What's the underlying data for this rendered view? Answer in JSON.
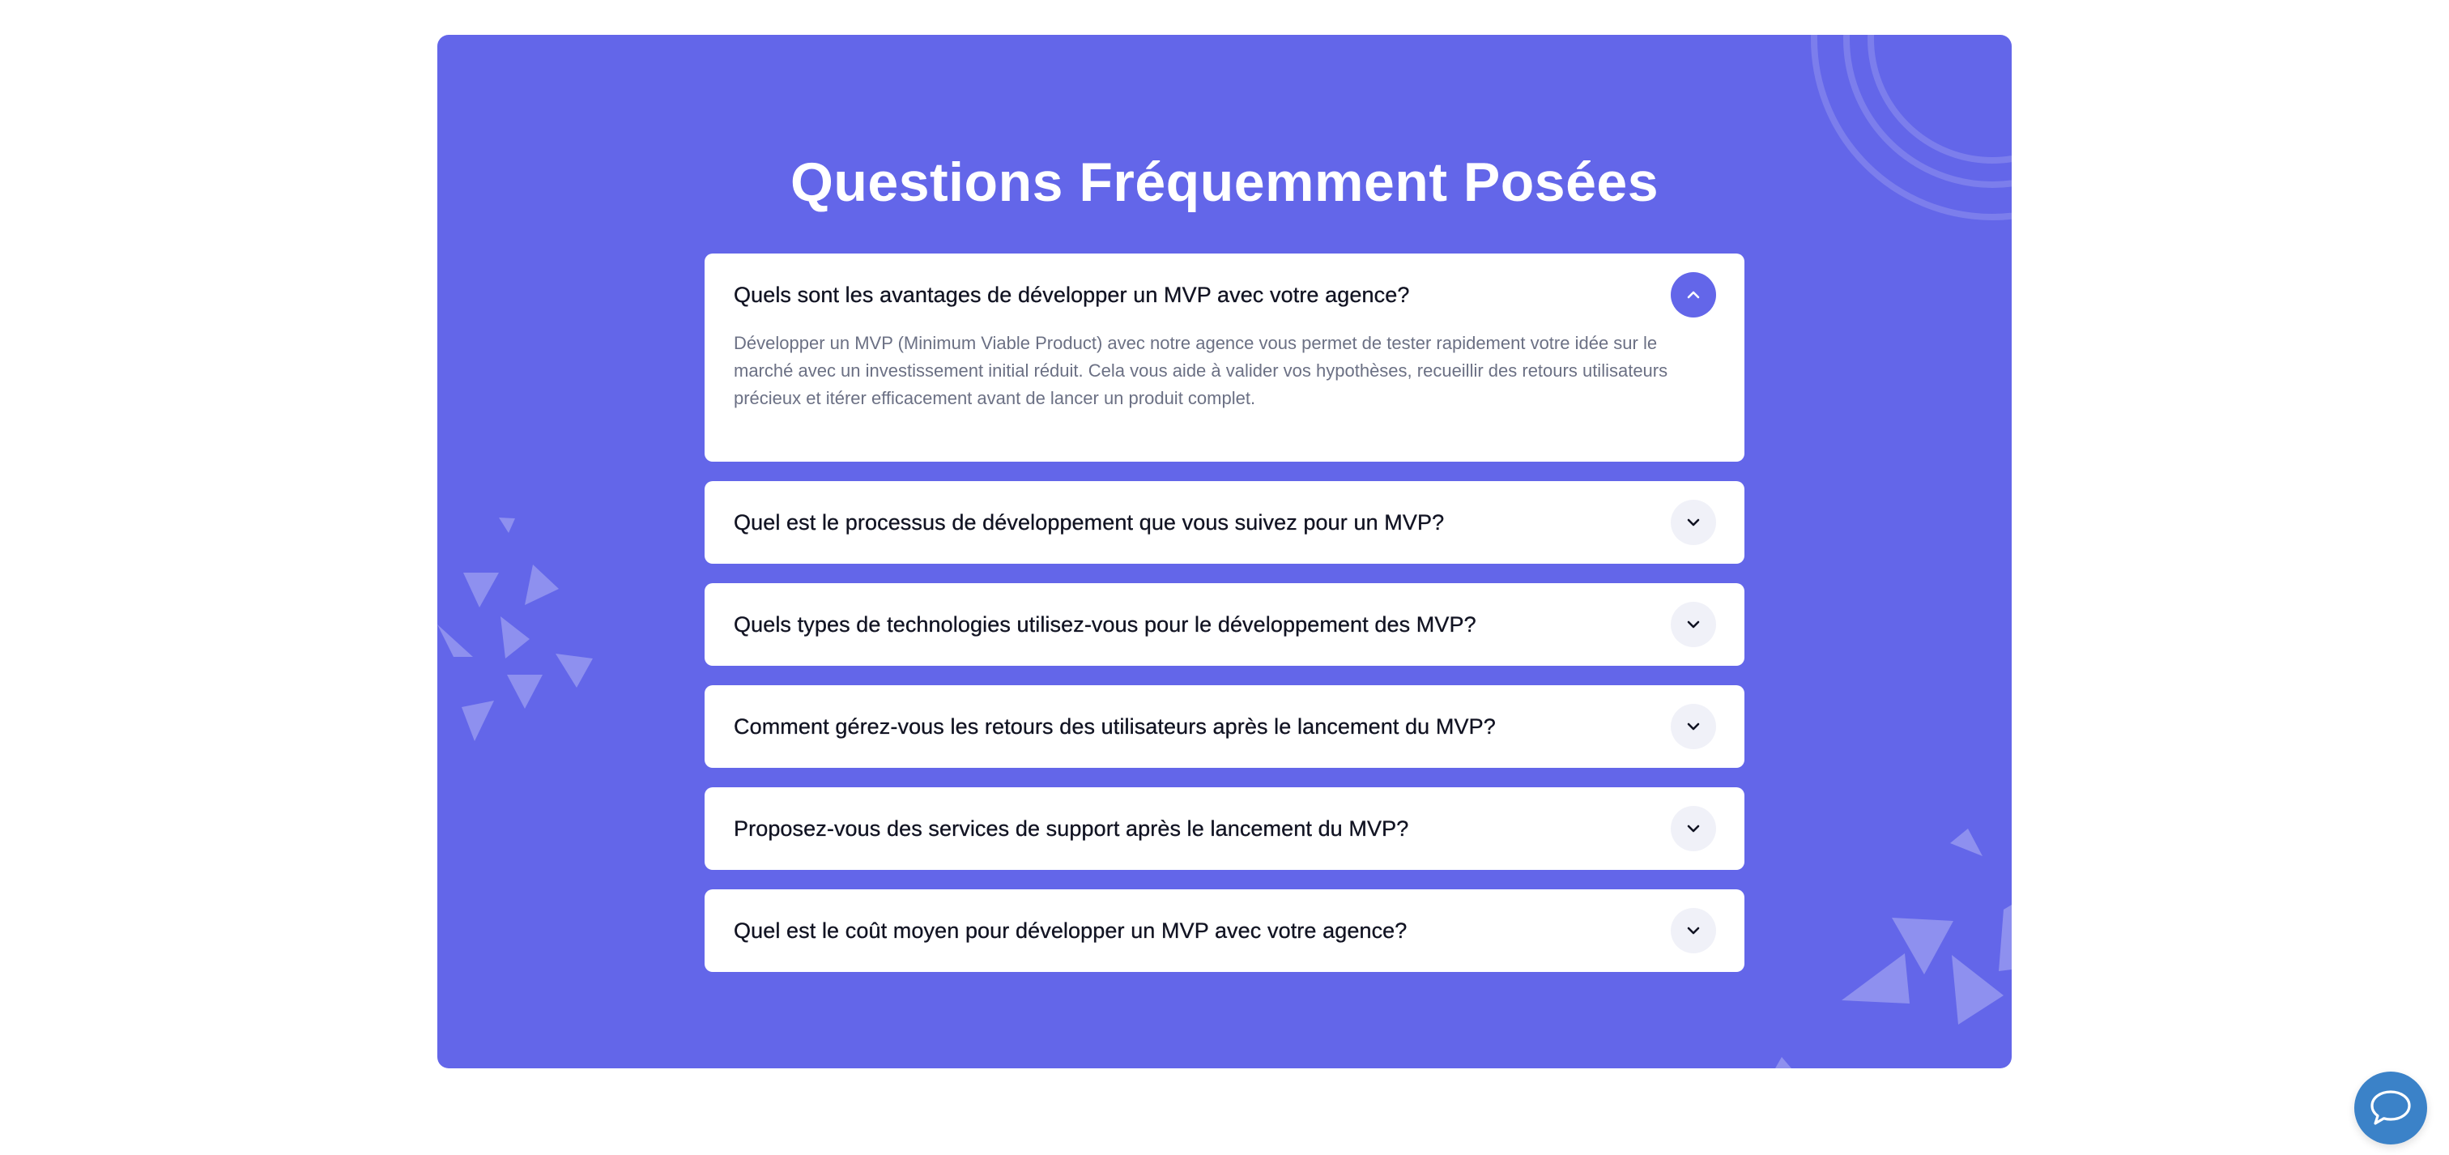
{
  "faq": {
    "title": "Questions Fréquemment Posées",
    "items": [
      {
        "question": "Quels sont les avantages de développer un MVP avec votre agence?",
        "answer": "Développer un MVP (Minimum Viable Product) avec notre agence vous permet de tester rapidement votre idée sur le marché avec un investissement initial réduit. Cela vous aide à valider vos hypothèses, recueillir des retours utilisateurs précieux et itérer efficacement avant de lancer un produit complet.",
        "expanded": true
      },
      {
        "question": "Quel est le processus de développement que vous suivez pour un MVP?",
        "expanded": false
      },
      {
        "question": "Quels types de technologies utilisez-vous pour le développement des MVP?",
        "expanded": false
      },
      {
        "question": "Comment gérez-vous les retours des utilisateurs après le lancement du MVP?",
        "expanded": false
      },
      {
        "question": "Proposez-vous des services de support après le lancement du MVP?",
        "expanded": false
      },
      {
        "question": "Quel est le coût moyen pour développer un MVP avec votre agence?",
        "expanded": false
      }
    ]
  },
  "icons": {
    "collapse": "chevron-up-icon",
    "expand": "chevron-down-icon",
    "chat": "chat-bubble-icon"
  },
  "colors": {
    "panel_background": "#6366e9",
    "card_background": "#ffffff",
    "toggle_open": "#6366e9",
    "toggle_closed": "#f0f1f8",
    "chat_button": "#3b82c8"
  }
}
